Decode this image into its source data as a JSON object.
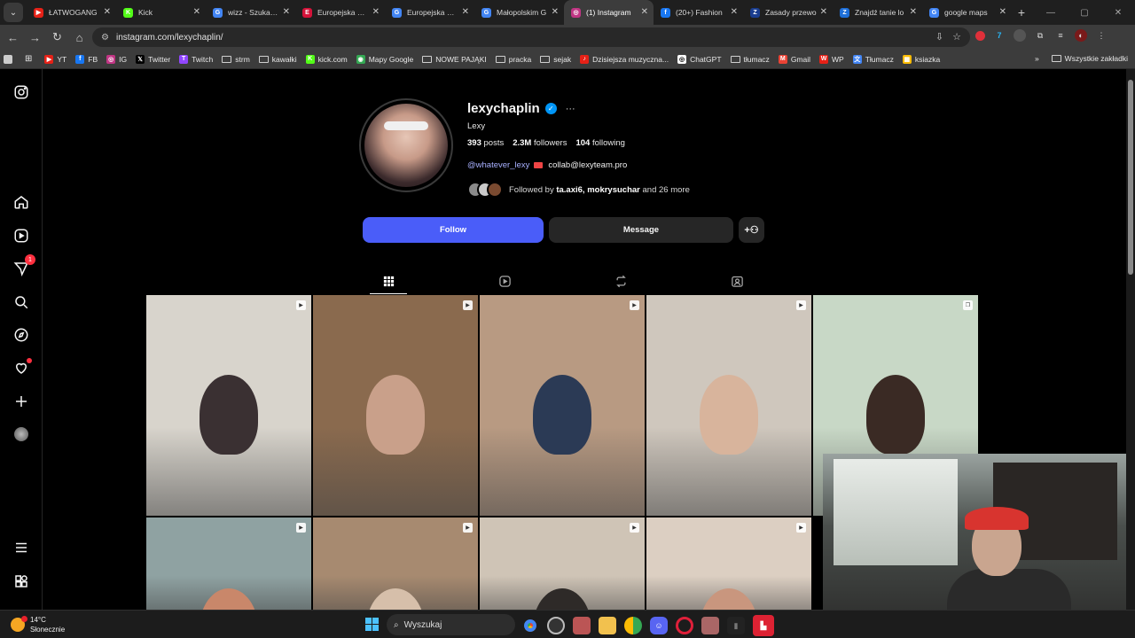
{
  "browser": {
    "tabs": [
      {
        "label": "ŁATWOGANG",
        "color": "#e62117",
        "glyph": "▶"
      },
      {
        "label": "Kick",
        "color": "#53fc18",
        "glyph": "K"
      },
      {
        "label": "wizz - Szukaj w",
        "color": "#4285f4",
        "glyph": "G"
      },
      {
        "label": "Europejska Kar",
        "color": "#d5133a",
        "glyph": "E"
      },
      {
        "label": "Europejska Kar",
        "color": "#4285f4",
        "glyph": "G"
      },
      {
        "label": "Małopolskim G",
        "color": "#4285f4",
        "glyph": "G"
      },
      {
        "label": "(1) Instagram",
        "color": "#c13584",
        "glyph": "◎",
        "active": true
      },
      {
        "label": "(20+) Fashion",
        "color": "#1877f2",
        "glyph": "f"
      },
      {
        "label": "Zasady przewo",
        "color": "#1a3d8f",
        "glyph": "Z"
      },
      {
        "label": "Znajdź tanie lo",
        "color": "#1e6fd9",
        "glyph": "Z"
      },
      {
        "label": "google maps",
        "color": "#4285f4",
        "glyph": "G"
      }
    ],
    "url": "instagram.com/lexychaplin/",
    "bookmarks": [
      {
        "label": "YT",
        "type": "icon",
        "color": "#e62117",
        "glyph": "▶"
      },
      {
        "label": "FB",
        "type": "icon",
        "color": "#1877f2",
        "glyph": "f"
      },
      {
        "label": "IG",
        "type": "icon",
        "color": "#c13584",
        "glyph": "◎"
      },
      {
        "label": "Twitter",
        "type": "icon",
        "color": "#000000",
        "glyph": "𝕏"
      },
      {
        "label": "Twitch",
        "type": "icon",
        "color": "#9146ff",
        "glyph": "T"
      },
      {
        "label": "strm",
        "type": "folder"
      },
      {
        "label": "kawałki",
        "type": "folder"
      },
      {
        "label": "kick.com",
        "type": "icon",
        "color": "#53fc18",
        "glyph": "K"
      },
      {
        "label": "Mapy Google",
        "type": "icon",
        "color": "#34a853",
        "glyph": "◉"
      },
      {
        "label": "NOWE PAJĄKI",
        "type": "folder"
      },
      {
        "label": "pracka",
        "type": "folder"
      },
      {
        "label": "sejak",
        "type": "folder"
      },
      {
        "label": "Dzisiejsza muzyczna...",
        "type": "icon",
        "color": "#e62117",
        "glyph": "♪"
      },
      {
        "label": "ChatGPT",
        "type": "icon",
        "color": "#ffffff",
        "glyph": "◎"
      },
      {
        "label": "tłumacz",
        "type": "folder"
      },
      {
        "label": "Gmail",
        "type": "icon",
        "color": "#ea4335",
        "glyph": "M"
      },
      {
        "label": "WP",
        "type": "icon",
        "color": "#e62117",
        "glyph": "W"
      },
      {
        "label": "Tłumacz",
        "type": "icon",
        "color": "#4285f4",
        "glyph": "文"
      },
      {
        "label": "ksiazka",
        "type": "icon",
        "color": "#fbbc04",
        "glyph": "▦"
      }
    ],
    "all_bookmarks_label": "Wszystkie zakładki"
  },
  "sidebar": {
    "messages_badge": "1"
  },
  "profile": {
    "username": "lexychaplin",
    "full_name": "Lexy",
    "posts_count": "393",
    "posts_label": "posts",
    "followers_count": "2.3M",
    "followers_label": "followers",
    "following_count": "104",
    "following_label": "following",
    "threads_handle": "@whatever_lexy",
    "email": "collab@lexyteam.pro",
    "followed_by_prefix": "Followed by",
    "followed_by_names": "ta.axi6, mokrysuchar",
    "followed_by_suffix": "and 26 more",
    "follow_label": "Follow",
    "message_label": "Message"
  },
  "posts": [
    {
      "type": "reel",
      "bg": "#d8d4cc",
      "tone": "#3a3032"
    },
    {
      "type": "reel",
      "bg": "#8a6a4e",
      "tone": "#c9a08a"
    },
    {
      "type": "reel",
      "bg": "#b89a82",
      "tone": "#2b3a55"
    },
    {
      "type": "reel",
      "bg": "#cfc7bd",
      "tone": "#d8b49c"
    },
    {
      "type": "carousel",
      "bg": "#c8d8c6",
      "tone": "#3a2a24"
    },
    {
      "type": "reel",
      "bg": "#8fa2a2",
      "tone": "#c9876a"
    },
    {
      "type": "reel",
      "bg": "#a78a70",
      "tone": "#d6bfaa"
    },
    {
      "type": "reel",
      "bg": "#cfc4b6",
      "tone": "#2e2a28"
    },
    {
      "type": "reel",
      "bg": "#dccfc2",
      "tone": "#c9967e"
    }
  ],
  "taskbar": {
    "temperature": "14°C",
    "condition": "Słonecznie",
    "search_placeholder": "Wyszukaj"
  }
}
